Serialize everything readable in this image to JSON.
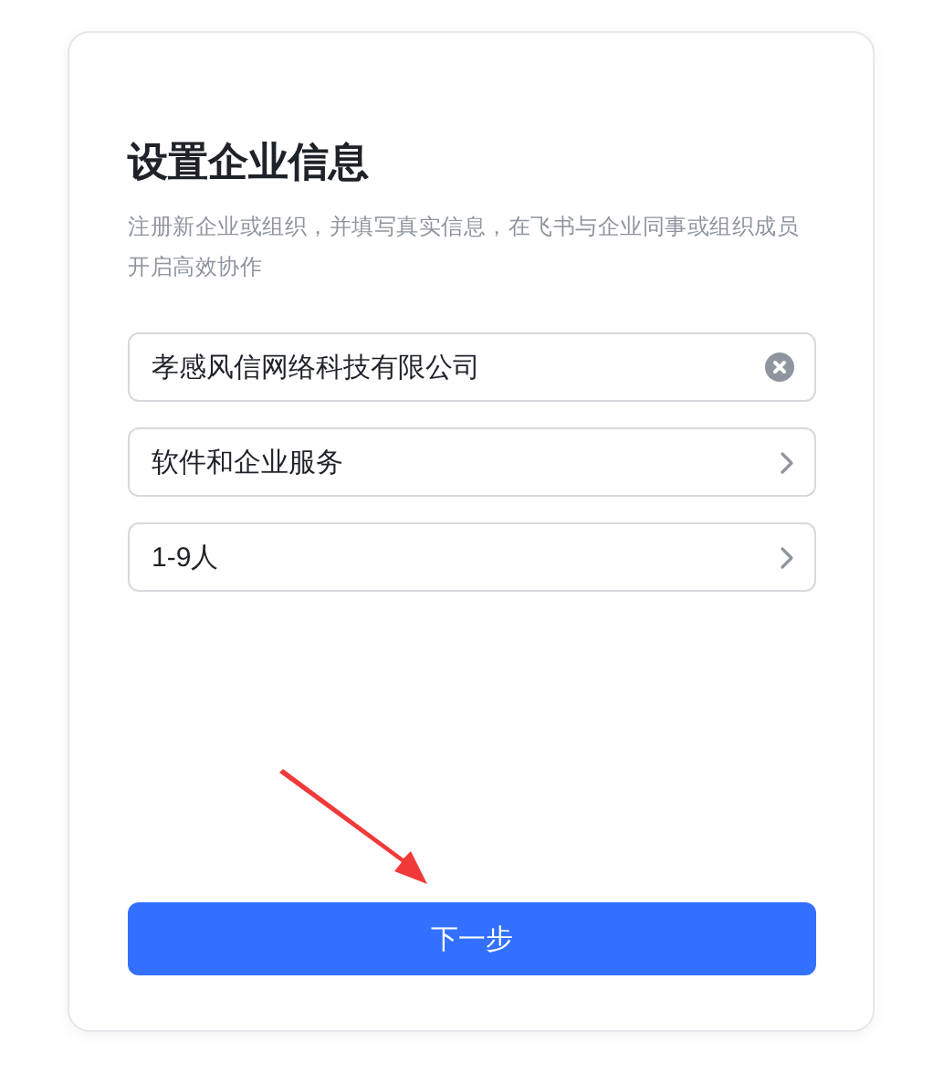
{
  "title": "设置企业信息",
  "subtitle": "注册新企业或组织，并填写真实信息，在飞书与企业同事或组织成员开启高效协作",
  "fields": [
    {
      "kind": "text",
      "value": "孝感风信网络科技有限公司"
    },
    {
      "kind": "select",
      "value": "软件和企业服务"
    },
    {
      "kind": "select",
      "value": "1-9人"
    }
  ],
  "next_button": "下一步"
}
